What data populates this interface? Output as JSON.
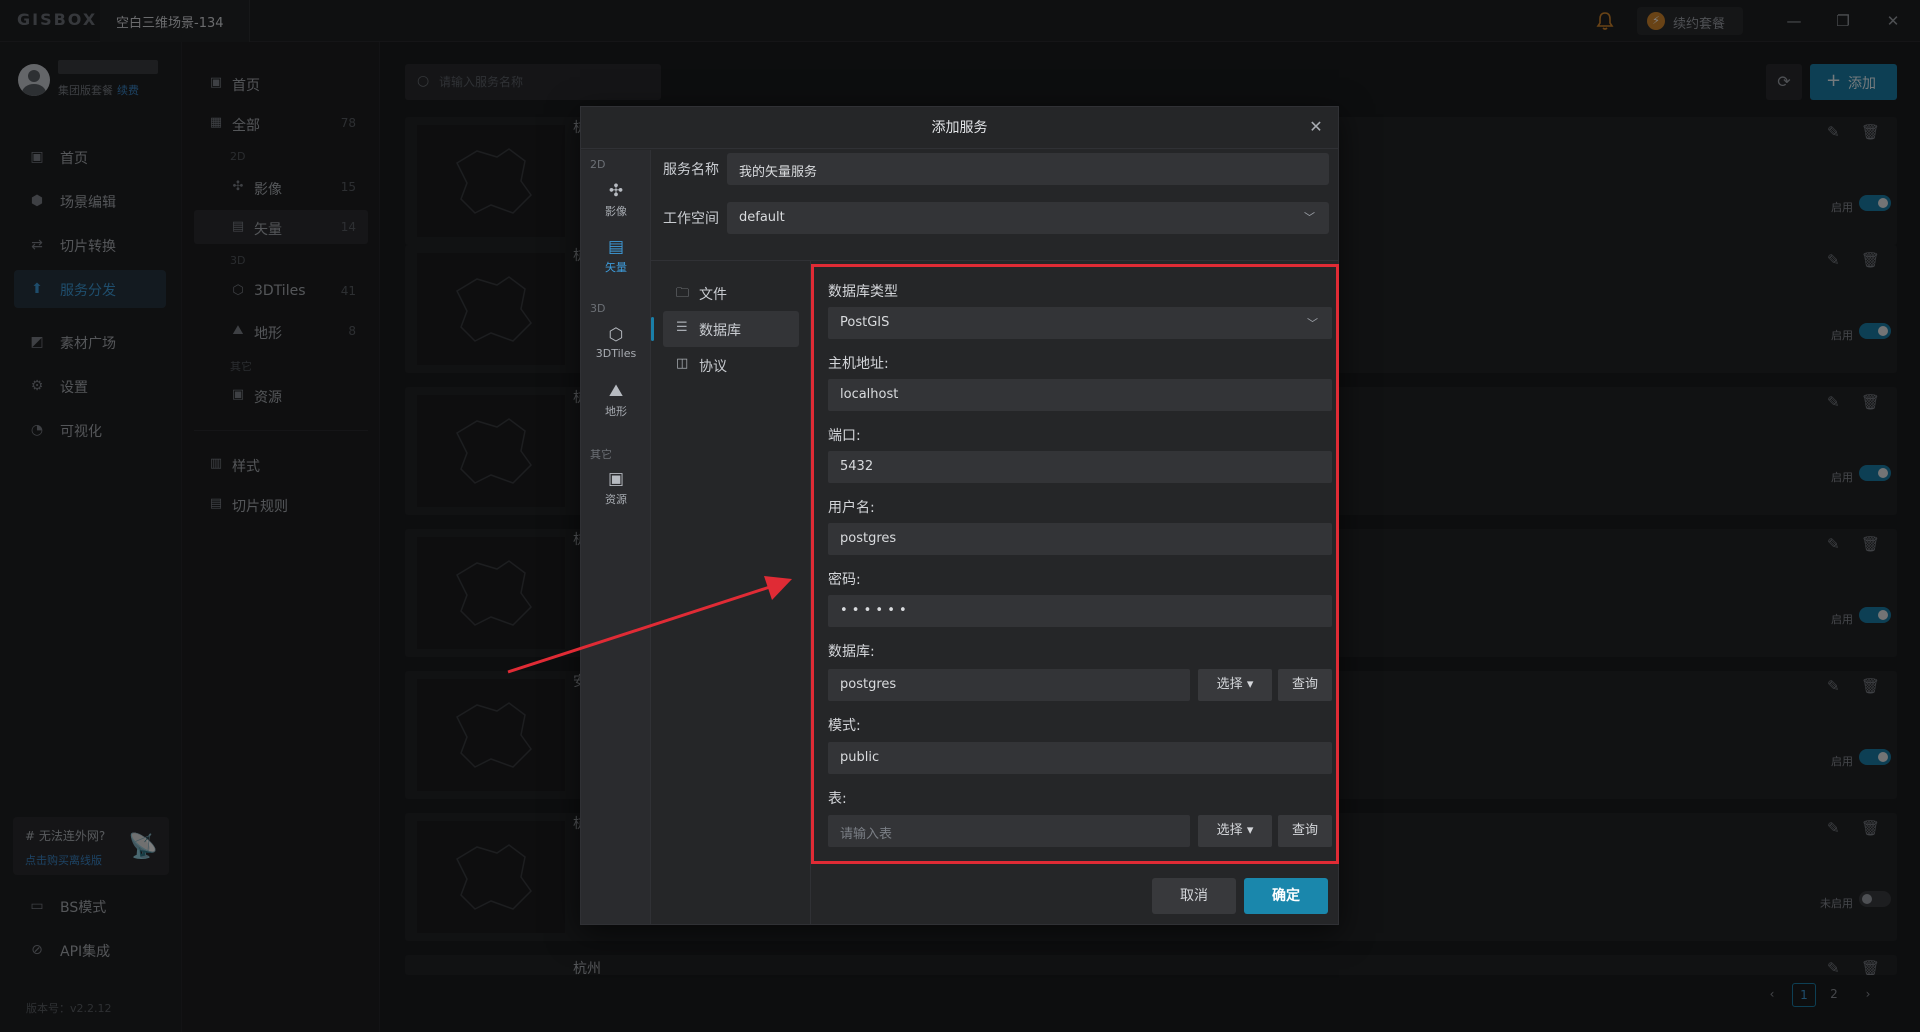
{
  "titlebar": {
    "logo": "GISBOX",
    "scene_tab": "空白三维场景-134",
    "renew_label": "续约套餐",
    "minimize": "—",
    "restore": "❐",
    "close": "✕"
  },
  "sidebar": {
    "plan_text": "集团版套餐",
    "plan_renew": "续费",
    "items": [
      {
        "label": "首页",
        "icon": "home-icon"
      },
      {
        "label": "场景编辑",
        "icon": "cube-icon"
      },
      {
        "label": "切片转换",
        "icon": "transform-icon"
      },
      {
        "label": "服务分发",
        "icon": "upload-cloud-icon"
      },
      {
        "label": "素材广场",
        "icon": "image-icon"
      },
      {
        "label": "设置",
        "icon": "gear-icon"
      },
      {
        "label": "可视化",
        "icon": "chart-icon"
      }
    ],
    "offline_title": "# 无法连外网?",
    "offline_link": "点击购买离线版",
    "bottom_items": [
      {
        "label": "BS模式"
      },
      {
        "label": "API集成"
      }
    ],
    "version": "版本号：v2.2.12"
  },
  "categories": {
    "home": "首页",
    "all": {
      "label": "全部",
      "count": "78"
    },
    "group_2d": "2D",
    "imagery": {
      "label": "影像",
      "count": "15"
    },
    "vector": {
      "label": "矢量",
      "count": "14"
    },
    "group_3d": "3D",
    "tiles3d": {
      "label": "3DTiles",
      "count": "41"
    },
    "terrain": {
      "label": "地形",
      "count": "8"
    },
    "group_other": "其它",
    "resource": {
      "label": "资源"
    },
    "style": "样式",
    "tile_rules": "切片规则"
  },
  "main": {
    "search_placeholder": "请输入服务名称",
    "add_label": "添加",
    "cards": [
      {
        "title_char": "杭",
        "status": "启用",
        "enabled": true
      },
      {
        "title_char": "杭",
        "status": "启用",
        "enabled": true
      },
      {
        "title_char": "杭",
        "status": "启用",
        "enabled": true
      },
      {
        "title_char": "杭",
        "status": "启用",
        "enabled": true
      },
      {
        "title_char": "安",
        "status": "启用",
        "enabled": true
      },
      {
        "title_char": "杭",
        "status": "未启用",
        "enabled": false
      },
      {
        "title_char": "杭州",
        "status": "",
        "enabled": true
      }
    ],
    "pages": [
      "1",
      "2"
    ],
    "prev": "‹",
    "next": "›"
  },
  "dialog": {
    "title": "添加服务",
    "left_group_2d": "2D",
    "left_group_3d": "3D",
    "left_group_other": "其它",
    "left_items": [
      {
        "label": "影像",
        "icon": "satellite-icon"
      },
      {
        "label": "矢量",
        "icon": "map-grid-icon"
      },
      {
        "label": "3DTiles",
        "icon": "box-3d-icon"
      },
      {
        "label": "地形",
        "icon": "mountain-icon"
      },
      {
        "label": "资源",
        "icon": "resource-icon"
      }
    ],
    "service_name_label": "服务名称",
    "service_name_value": "我的矢量服务",
    "workspace_label": "工作空间",
    "workspace_value": "default",
    "subnav": [
      {
        "label": "文件",
        "icon": "folder-icon"
      },
      {
        "label": "数据库",
        "icon": "database-icon"
      },
      {
        "label": "协议",
        "icon": "protocol-icon"
      }
    ],
    "db": {
      "type_label": "数据库类型",
      "type_value": "PostGIS",
      "host_label": "主机地址:",
      "host_value": "localhost",
      "port_label": "端口:",
      "port_value": "5432",
      "user_label": "用户名:",
      "user_value": "postgres",
      "password_label": "密码:",
      "password_value": "• • • • • •",
      "database_label": "数据库:",
      "database_value": "postgres",
      "schema_label": "模式:",
      "schema_value": "public",
      "table_label": "表:",
      "table_placeholder": "请输入表",
      "select_label": "选择",
      "query_label": "查询"
    },
    "cancel": "取消",
    "ok": "确定"
  },
  "colors": {
    "accent": "#1a7fa8",
    "highlight": "#e02b35"
  }
}
